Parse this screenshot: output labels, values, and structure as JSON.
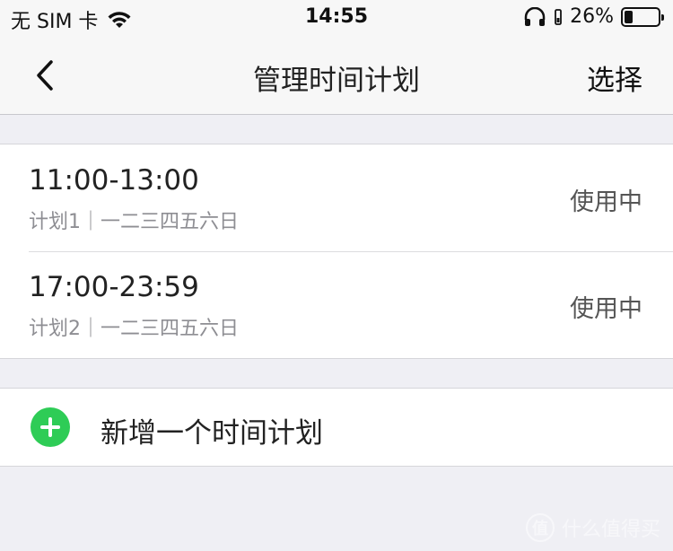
{
  "status_bar": {
    "carrier": "无 SIM 卡",
    "time": "14:55",
    "battery_percent": "26%",
    "battery_level": 0.26,
    "icons": [
      "wifi-icon",
      "headphones-icon",
      "battery-icon"
    ]
  },
  "nav": {
    "title": "管理时间计划",
    "action": "选择"
  },
  "plans": [
    {
      "time": "11:00-13:00",
      "subtitle": "计划1｜一二三四五六日",
      "status": "使用中"
    },
    {
      "time": "17:00-23:59",
      "subtitle": "计划2｜一二三四五六日",
      "status": "使用中"
    }
  ],
  "add": {
    "label": "新增一个时间计划",
    "icon_color": "#2ecc56"
  },
  "watermark": {
    "logo": "值",
    "text": "什么值得买"
  }
}
